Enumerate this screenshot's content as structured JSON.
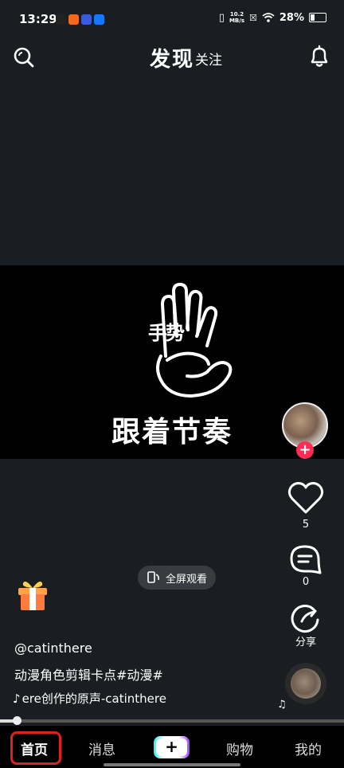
{
  "status_bar": {
    "time": "13:29",
    "network_speed_value": "10.2",
    "network_speed_unit": "MB/s",
    "battery": "28%",
    "app_icon_colors": [
      "#222222",
      "#f26b1d",
      "#3a5bdc",
      "#1677ff"
    ]
  },
  "header": {
    "title": "发现",
    "follow_label": "关注",
    "icons": [
      "search-icon",
      "bell-icon"
    ]
  },
  "video": {
    "caption": "跟着节奏",
    "hand_text": "手势"
  },
  "actions": {
    "like_count": "5",
    "comment_count": "0",
    "share_label": "分享",
    "follow_plus": "+"
  },
  "overlay": {
    "fullscreen_label": "全屏观看",
    "username": "@catinthere",
    "description": "动漫角色剪辑卡点#动漫#",
    "music_text": "ere创作的原声-catinthere"
  },
  "progress": {
    "fraction": 0.05
  },
  "bottom_nav": {
    "home": "首页",
    "messages": "消息",
    "create": "+",
    "shop": "购物",
    "me": "我的"
  },
  "colors": {
    "accent": "#fe2c55",
    "highlight": "#e0201e",
    "background": "#1a1d21"
  }
}
